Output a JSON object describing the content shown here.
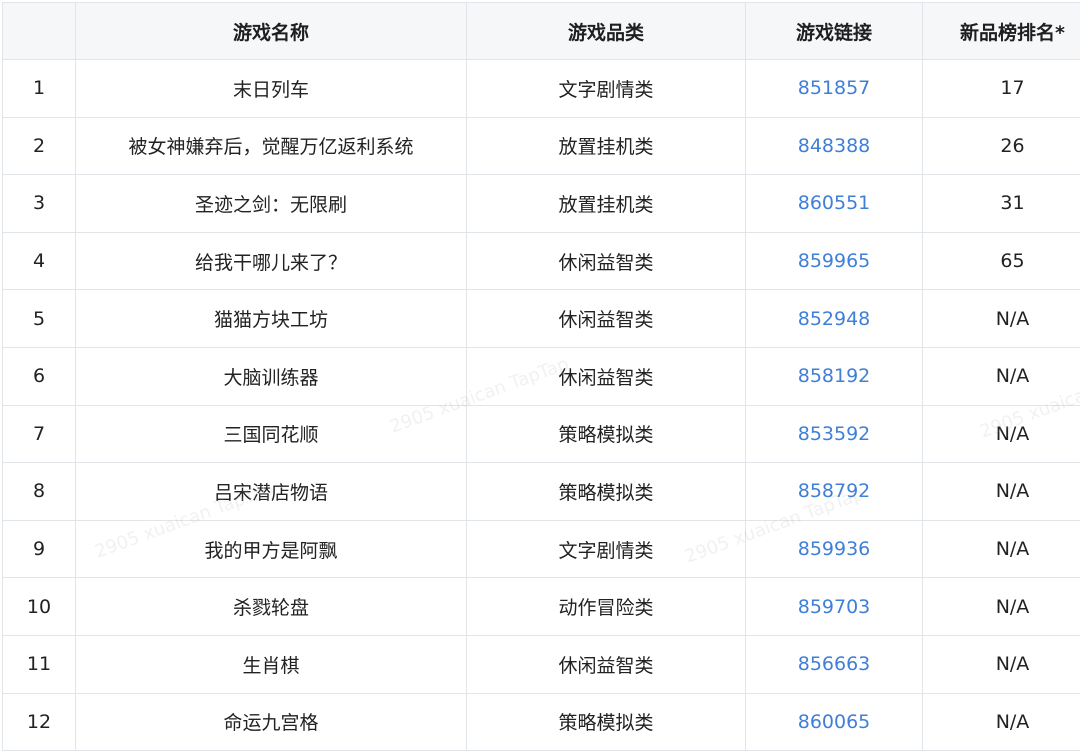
{
  "table": {
    "headers": {
      "index": "",
      "name": "游戏名称",
      "category": "游戏品类",
      "link": "游戏链接",
      "rank": "新品榜排名*"
    },
    "rows": [
      {
        "index": "1",
        "name": "末日列车",
        "category": "文字剧情类",
        "link": "851857",
        "rank": "17"
      },
      {
        "index": "2",
        "name": "被女神嫌弃后，觉醒万亿返利系统",
        "category": "放置挂机类",
        "link": "848388",
        "rank": "26"
      },
      {
        "index": "3",
        "name": "圣迹之剑：无限刷",
        "category": "放置挂机类",
        "link": "860551",
        "rank": "31"
      },
      {
        "index": "4",
        "name": "给我干哪儿来了？",
        "category": "休闲益智类",
        "link": "859965",
        "rank": "65"
      },
      {
        "index": "5",
        "name": "猫猫方块工坊",
        "category": "休闲益智类",
        "link": "852948",
        "rank": "N/A"
      },
      {
        "index": "6",
        "name": "大脑训练器",
        "category": "休闲益智类",
        "link": "858192",
        "rank": "N/A"
      },
      {
        "index": "7",
        "name": "三国同花顺",
        "category": "策略模拟类",
        "link": "853592",
        "rank": "N/A"
      },
      {
        "index": "8",
        "name": "吕宋潜店物语",
        "category": "策略模拟类",
        "link": "858792",
        "rank": "N/A"
      },
      {
        "index": "9",
        "name": "我的甲方是阿飘",
        "category": "文字剧情类",
        "link": "859936",
        "rank": "N/A"
      },
      {
        "index": "10",
        "name": "杀戮轮盘",
        "category": "动作冒险类",
        "link": "859703",
        "rank": "N/A"
      },
      {
        "index": "11",
        "name": "生肖棋",
        "category": "休闲益智类",
        "link": "856663",
        "rank": "N/A"
      },
      {
        "index": "12",
        "name": "命运九宫格",
        "category": "策略模拟类",
        "link": "860065",
        "rank": "N/A"
      }
    ]
  },
  "watermark": {
    "text": "2905 xuaican TapTap"
  },
  "colors": {
    "header_bg": "#f6f7f8",
    "border": "#e1e4e8",
    "link": "#3f7fd8",
    "text": "#222222"
  }
}
